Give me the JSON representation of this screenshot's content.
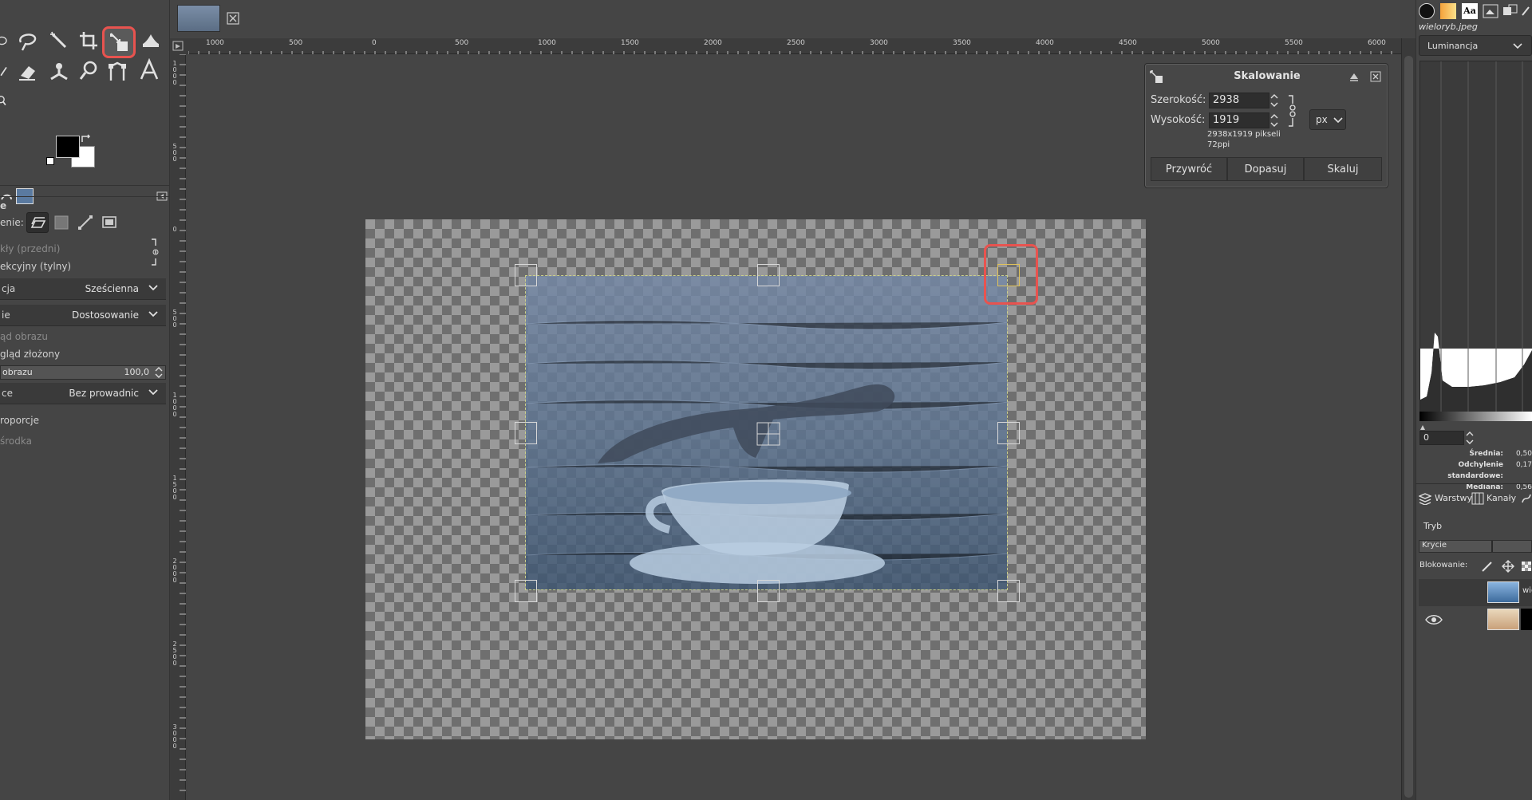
{
  "toolbox": {
    "options": {
      "direction_label": "enie:",
      "direction_forward": "kły (przedni)",
      "direction_backward": "ekcyjny (tylny)",
      "interpolation_key": "cja",
      "interpolation_value": "Sześcienna",
      "clipping_key": "ie",
      "clipping_value": "Dostosowanie",
      "show_image": "ąd obrazu",
      "composite_preview": "gląd złożony",
      "image_opacity_key": "obrazu",
      "image_opacity_value": "100,0",
      "guides_key": "ce",
      "guides_value": "Bez prowadnic",
      "keep_aspect": "roporcje",
      "around_center": "środka",
      "header_char": "e"
    }
  },
  "rulers": {
    "h_ticks": [
      "1000",
      "500",
      "0",
      "500",
      "1000",
      "1500",
      "2000",
      "2500",
      "3000",
      "3500",
      "4000",
      "4500",
      "5000",
      "5500",
      "6000"
    ],
    "v_ticks": [
      "1000",
      "500",
      "0",
      "500",
      "1000",
      "1500",
      "2000",
      "2500",
      "3000"
    ]
  },
  "scale_dialog": {
    "title": "Skalowanie",
    "width_label": "Szerokość:",
    "width_value": "2938",
    "height_label": "Wysokość:",
    "height_value": "1919",
    "info_pixels": "2938x1919 pikseli",
    "info_ppi": "72ppi",
    "unit": "px",
    "reset_button": "Przywróć",
    "fit_button": "Dopasuj",
    "scale_button": "Skaluj"
  },
  "right_dock": {
    "image_name": "wieloryb.jpeg",
    "channel": "Luminancja",
    "range_start": "0",
    "stats": {
      "mean_label": "Średnia:",
      "mean_value": "0,50",
      "stddev_label": "Odchylenie standardowe:",
      "stddev_value": "0,17",
      "median_label": "Mediana:",
      "median_value": "0,56"
    },
    "layers_tab": "Warstwy",
    "channels_tab": "Kanały",
    "mode_label": "Tryb",
    "opacity_label": "Krycie",
    "lock_label": "Blokowanie:",
    "layer1_name": "wie"
  }
}
